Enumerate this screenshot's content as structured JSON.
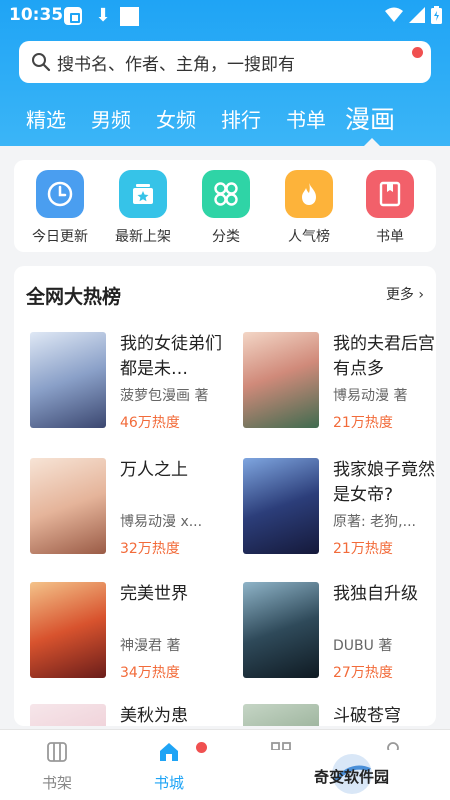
{
  "status_bar": {
    "time": "10:35"
  },
  "search": {
    "placeholder": "搜书名、作者、主角，一搜即有"
  },
  "tabs": [
    {
      "label": "精选"
    },
    {
      "label": "男频"
    },
    {
      "label": "女频"
    },
    {
      "label": "排行"
    },
    {
      "label": "书单"
    },
    {
      "label": "漫画",
      "active": true
    }
  ],
  "quick_links": [
    {
      "label": "今日更新",
      "icon": "clock-icon",
      "color": "#4a9ef0"
    },
    {
      "label": "最新上架",
      "icon": "star-box-icon",
      "color": "#36c3e8"
    },
    {
      "label": "分类",
      "icon": "grid-icon",
      "color": "#2fd4a6"
    },
    {
      "label": "人气榜",
      "icon": "flame-icon",
      "color": "#fdb33a"
    },
    {
      "label": "书单",
      "icon": "bookmark-icon",
      "color": "#f2606a"
    }
  ],
  "hot_list": {
    "title": "全网大热榜",
    "more": "更多",
    "books": [
      {
        "title": "我的女徒弟们都是未…",
        "author": "菠萝包漫画 著",
        "heat": "46万热度"
      },
      {
        "title": "我的夫君后宫有点多",
        "author": "博易动漫 著",
        "heat": "21万热度"
      },
      {
        "title": "万人之上",
        "author": "博易动漫 x...",
        "heat": "32万热度"
      },
      {
        "title": "我家娘子竟然是女帝?",
        "author": "原著: 老狗,...",
        "heat": "21万热度"
      },
      {
        "title": "完美世界",
        "author": "神漫君 著",
        "heat": "34万热度"
      },
      {
        "title": "我独自升级",
        "author": "DUBU 著",
        "heat": "27万热度"
      },
      {
        "title": "美秋为患",
        "author": "",
        "heat": ""
      },
      {
        "title": "斗破苍穹",
        "author": "",
        "heat": ""
      }
    ]
  },
  "bottom_nav": [
    {
      "label": "书架"
    },
    {
      "label": "书城",
      "active": true
    }
  ],
  "watermark": {
    "text": "奇变软件园"
  },
  "colors": {
    "accent": "#1fa4f5",
    "heat": "#f26b3a",
    "badge": "#f05050"
  }
}
